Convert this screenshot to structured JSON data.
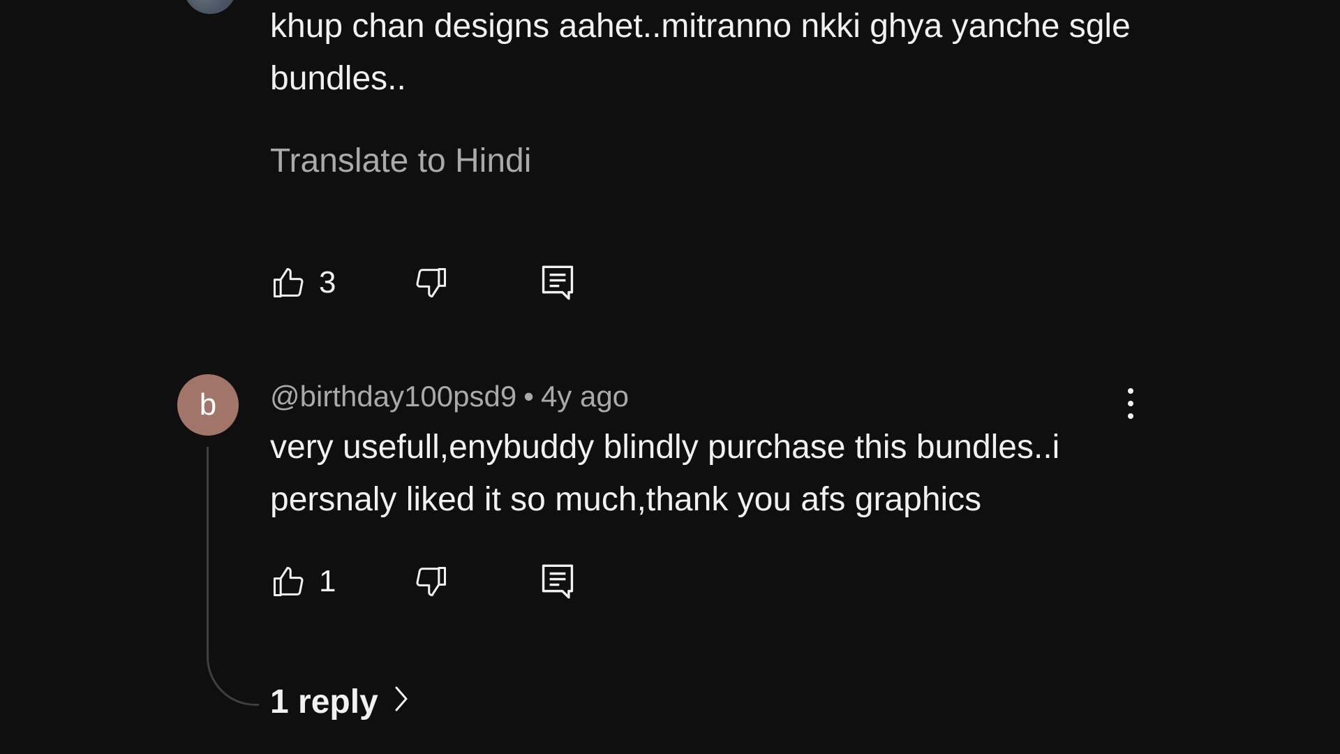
{
  "comment1": {
    "text": "khup chan designs aahet..mitranno nkki ghya yanche sgle bundles..",
    "translate_label": "Translate to Hindi",
    "likes": "3"
  },
  "comment2": {
    "avatar_letter": "b",
    "avatar_color": "#a1756a",
    "author": "@birthday100psd9",
    "separator": "•",
    "time": "4y ago",
    "text": "very usefull,enybuddy blindly purchase this bundles..i persnaly liked it so much,thank you afs graphics",
    "likes": "1",
    "replies_label": "1 reply"
  },
  "icons": {
    "like": "thumbs-up-icon",
    "dislike": "thumbs-down-icon",
    "reply": "comment-reply-icon",
    "more": "more-vertical-icon",
    "chevron": "chevron-right-icon"
  }
}
